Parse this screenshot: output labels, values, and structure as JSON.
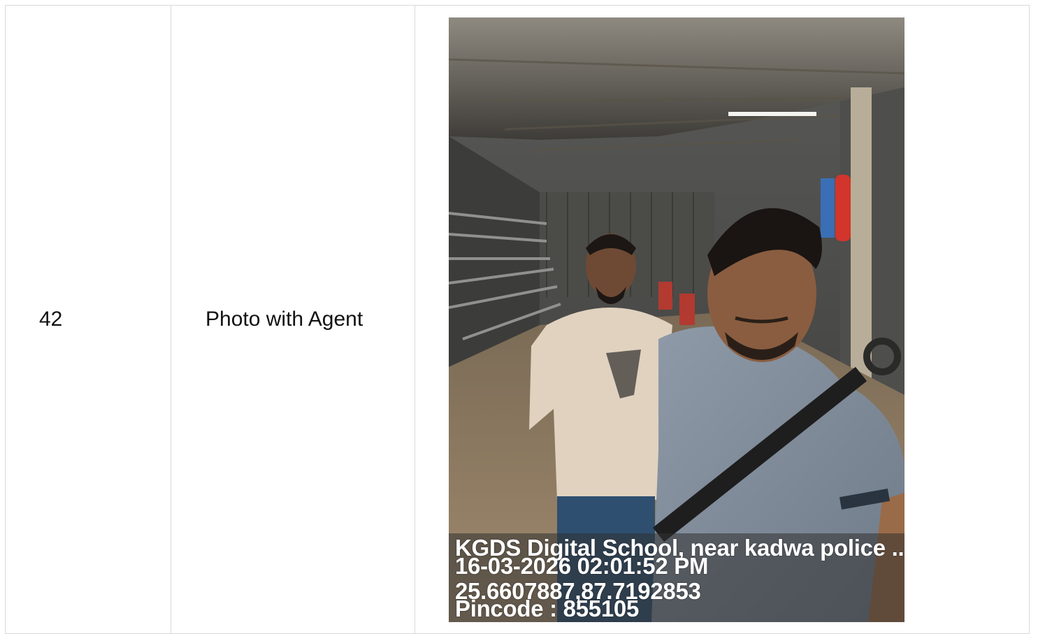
{
  "row": {
    "number": "42",
    "label": "Photo with Agent"
  },
  "photo": {
    "description_icon": "photo-icon",
    "stamp": {
      "location": "KGDS Digital School, near kadwa police ...",
      "datetime": "16-03-2026 02:01:52 PM",
      "coordinates": "25.6607887,87.7192853",
      "pincode": "Pincode : 855105"
    }
  },
  "colors": {
    "border": "#d9d9d9",
    "text": "#111111",
    "stamp_text": "#ffffff"
  }
}
